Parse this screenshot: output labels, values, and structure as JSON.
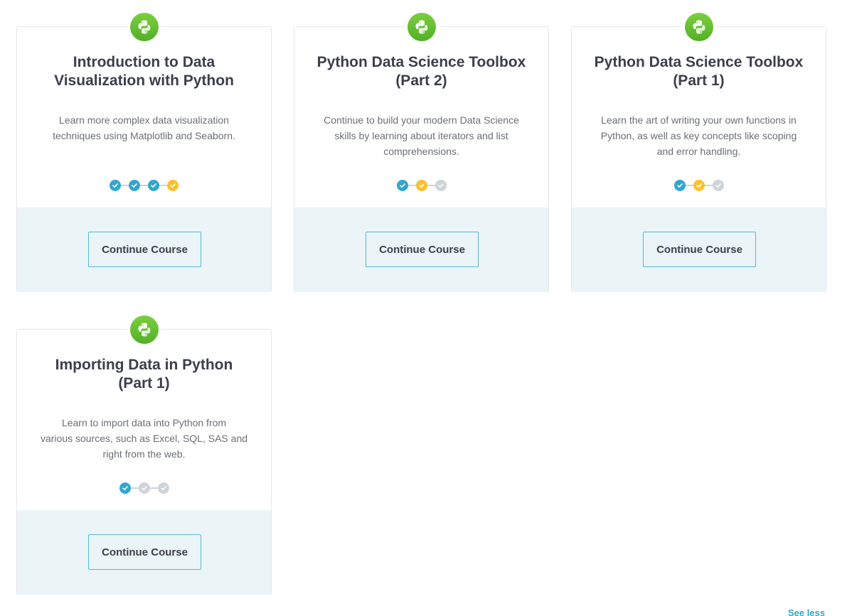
{
  "colors": {
    "badge_green": "#5cbf2a",
    "step_done_blue": "#33a6cc",
    "step_current_yellow": "#fbc02d",
    "step_todo_grey": "#cfd4d8",
    "button_border": "#56b8d3",
    "link": "#33a6cc"
  },
  "courses": [
    {
      "icon": "python-icon",
      "title_line1": "Introduction to Data",
      "title_line2": "Visualization with Python",
      "desc_line1": "Learn more complex data visualization",
      "desc_line2": "techniques using Matplotlib and Seaborn.",
      "desc_line3": "",
      "steps": [
        "done",
        "done",
        "done",
        "current"
      ],
      "button_label": "Continue Course"
    },
    {
      "icon": "python-icon",
      "title_line1": "Python Data Science Toolbox",
      "title_line2": "(Part 2)",
      "desc_line1": "Continue to build your modern Data Science",
      "desc_line2": "skills by learning about iterators and list",
      "desc_line3": "comprehensions.",
      "steps": [
        "done",
        "current",
        "todo"
      ],
      "button_label": "Continue Course"
    },
    {
      "icon": "python-icon",
      "title_line1": "Python Data Science Toolbox",
      "title_line2": "(Part 1)",
      "desc_line1": "Learn the art of writing your own functions in",
      "desc_line2": "Python, as well as key concepts like scoping",
      "desc_line3": "and error handling.",
      "steps": [
        "done",
        "current",
        "todo"
      ],
      "button_label": "Continue Course"
    },
    {
      "icon": "python-icon",
      "title_line1": "Importing Data in Python",
      "title_line2": "(Part 1)",
      "desc_line1": "Learn to import data into Python from",
      "desc_line2": "various sources, such as Excel, SQL, SAS and",
      "desc_line3": "right from the web.",
      "steps": [
        "done",
        "todo",
        "todo"
      ],
      "button_label": "Continue Course"
    }
  ],
  "footer": {
    "see_less_label": "See less"
  }
}
